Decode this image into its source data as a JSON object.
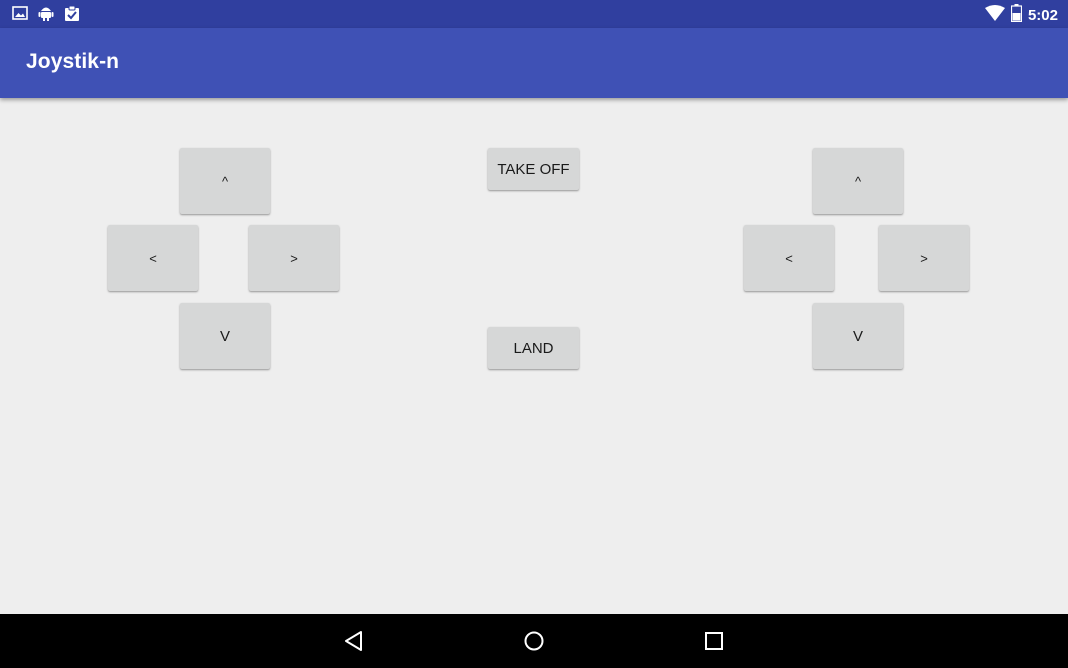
{
  "status_bar": {
    "time": "5:02",
    "left_icons": [
      "image-icon",
      "android-icon",
      "clipboard-check-icon"
    ],
    "right_icons": [
      "wifi-icon",
      "battery-icon"
    ]
  },
  "app_bar": {
    "title": "Joystik-n"
  },
  "left_pad": {
    "up": "^",
    "left": "<",
    "right": ">",
    "down": "V"
  },
  "center": {
    "takeoff": "TAKE OFF",
    "land": "LAND"
  },
  "right_pad": {
    "up": "^",
    "left": "<",
    "right": ">",
    "down": "V"
  },
  "nav_bar": {
    "icons": [
      "back-icon",
      "home-icon",
      "recents-icon"
    ]
  },
  "colors": {
    "status_bar": "#303f9f",
    "app_bar": "#3f51b5",
    "background": "#eeeeee",
    "button": "#d6d7d7"
  }
}
